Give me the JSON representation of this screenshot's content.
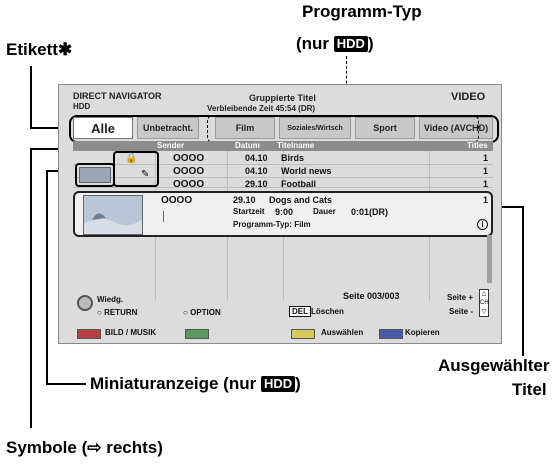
{
  "callouts": {
    "programm_typ": "Programm-Typ",
    "nur_hdd_top_prefix": "(nur ",
    "nur_hdd_top_suffix": ")",
    "hdd": "HDD",
    "etikett": "Etikett",
    "etikett_mark": "✱",
    "miniatur": "Miniaturanzeige (nur ",
    "miniatur_suffix": ")",
    "ausgewaehlter": "Ausgewählter",
    "titel": "Titel",
    "symbole": "Symbole (⇨ rechts)"
  },
  "screen": {
    "direct_navigator": "DIRECT NAVIGATOR",
    "hdd_label": "HDD",
    "gruppierte_titel": "Gruppierte Titel",
    "verbleibende": "Verbleibende Zeit 45:54 (DR)",
    "video": "VIDEO",
    "tabs": [
      "Alle",
      "Unbetracht.",
      "Film",
      "Soziales/Wirtsch",
      "Sport",
      "Video (AVCHD)"
    ],
    "columns": {
      "sender": "Sender",
      "datum": "Datum",
      "titelname": "Titelname",
      "titles": "Titles"
    },
    "rows": [
      {
        "circles": "OOOO",
        "date": "04.10",
        "name": "Birds",
        "count": "1"
      },
      {
        "circles": "OOOO",
        "date": "04.10",
        "name": "World news",
        "count": "1"
      },
      {
        "circles": "OOOO",
        "date": "29.10",
        "name": "Football",
        "count": "1"
      }
    ],
    "selected": {
      "circles": "OOOO",
      "date": "29.10",
      "name": "Dogs and Cats",
      "count": "1",
      "startzeit_label": "Startzeit",
      "startzeit": "9:00",
      "dauer_label": "Dauer",
      "dauer": "0:01(DR)",
      "programm_typ": "Programm-Typ: Film",
      "info": "i"
    },
    "seite": "Seite 003/003",
    "seite_plus": "Seite +",
    "seite_minus": "Seite -",
    "ch": "CH",
    "wiedg": "Wiedg.",
    "return": "RETURN",
    "option": "OPTION",
    "del": "DEL",
    "loeschen": "Löschen",
    "bild_musik": "BILD / MUSIK",
    "auswaehlen": "Auswählen",
    "kopieren": "Kopieren"
  },
  "colors": {
    "screen_bg": "#dcdcdc",
    "red": "#b84040",
    "green": "#5a9a5a",
    "yellow": "#d8c860",
    "blue": "#4a5aa8"
  }
}
